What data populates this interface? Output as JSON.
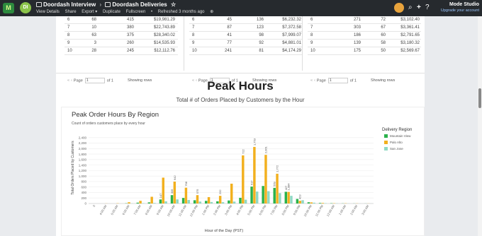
{
  "topbar": {
    "logo_letter": "M",
    "workspace_initials": "DI",
    "report_space": "Doordash Interview",
    "separator": "›",
    "report_title": "Doordash Deliveries",
    "star": "☆",
    "menu": [
      "View Details",
      "Share",
      "Export ▾",
      "Duplicate",
      "Fullscreen",
      "•",
      "Refreshed 3 months ago",
      "⊕"
    ],
    "org_name": "Mode Studio",
    "upgrade_text": "Upgrade your account",
    "icons": [
      "search-icon",
      "plus-icon",
      "help-icon"
    ]
  },
  "tables": [
    {
      "rows": [
        [
          "6",
          "68",
          "415",
          "$19,981.29"
        ],
        [
          "7",
          "10",
          "380",
          "$22,743.89"
        ],
        [
          "8",
          "63",
          "375",
          "$28,340.02"
        ],
        [
          "9",
          "3",
          "260",
          "$14,535.93"
        ],
        [
          "10",
          "28",
          "245",
          "$12,112.76"
        ]
      ]
    },
    {
      "rows": [
        [
          "6",
          "45",
          "136",
          "$6,232.32"
        ],
        [
          "7",
          "87",
          "123",
          "$7,372.58"
        ],
        [
          "8",
          "41",
          "98",
          "$7,999.07"
        ],
        [
          "9",
          "77",
          "92",
          "$4,881.01"
        ],
        [
          "10",
          "241",
          "81",
          "$4,174.29"
        ]
      ]
    },
    {
      "rows": [
        [
          "6",
          "271",
          "72",
          "$3,102.40"
        ],
        [
          "7",
          "303",
          "67",
          "$3,361.41"
        ],
        [
          "8",
          "186",
          "60",
          "$2,791.65"
        ],
        [
          "9",
          "139",
          "58",
          "$3,180.32"
        ],
        [
          "10",
          "175",
          "50",
          "$2,569.67"
        ]
      ]
    }
  ],
  "pager": {
    "page_label": "Page",
    "page_value": "1",
    "of_label": "of 1",
    "showing_label": "Showing rows"
  },
  "section": {
    "title": "Peak Hours",
    "subtitle": "Total # of Orders Placed by Customers by the Hour"
  },
  "chart_data": {
    "type": "bar",
    "title": "Peak Order Hours By Region",
    "description": "Count of orders customers place by every hour",
    "xlabel": "Hour of the Day (PST)",
    "ylabel": "Total Orders Placed by Customers",
    "ylim": [
      0,
      2600
    ],
    "yticks": [
      "0",
      "200",
      "400",
      "600",
      "800",
      "1,000",
      "1,200",
      "1,400",
      "1,600",
      "1,800",
      "2,000",
      "2,200",
      "2,400"
    ],
    "grid": true,
    "legend_title": "Delivery Region",
    "legend_position": "right",
    "categories": [
      "0",
      "4:00 AM",
      "5:00 AM",
      "6:00 AM",
      "7:00 AM",
      "8:00 AM",
      "9:00 AM",
      "10:00 AM",
      "11:00 AM",
      "12:00 PM",
      "1:00 PM",
      "2:00 PM",
      "3:00 PM",
      "4:00 PM",
      "5:00 PM",
      "6:00 PM",
      "7:00 PM",
      "8:00 PM",
      "9:00 PM",
      "10:00 PM",
      "11:00 PM",
      "12:00 AM",
      "1:00 AM",
      "2:00 AM",
      "3:00 AM"
    ],
    "tick_labels": [
      "0",
      "4:00 AM",
      "5:00 AM",
      "6:00 AM",
      "7:00 AM",
      "8:00 AM",
      "9:00 AM",
      "10:00 AM",
      "11:00 AM",
      "12:00 PM",
      "1:00 PM",
      "2:00 PM",
      "3:00 PM",
      "4:00 PM",
      "5:00 PM",
      "6:00 PM",
      "7:00 PM",
      "8:00 PM",
      "9:00 PM",
      "10:00 PM",
      "11:00 PM",
      "12:00 AM",
      "1:00 AM",
      "2:00 AM",
      "3:00 AM"
    ],
    "series": [
      {
        "name": "Mountain View",
        "color": "#2bb24c",
        "values": [
          0,
          0,
          0,
          8,
          30,
          40,
          147,
          305,
          202,
          119,
          96,
          80,
          110,
          208,
          617,
          638,
          569,
          427,
          166,
          45,
          20,
          10,
          5,
          3,
          2
        ]
      },
      {
        "name": "Palo Alto",
        "color": "#f2b01e",
        "values": [
          0,
          3,
          8,
          46,
          98,
          245,
          942,
          798,
          575,
          305,
          232,
          280,
          722,
          1753,
          2061,
          1772,
          1084,
          423,
          100,
          40,
          20,
          10,
          8,
          5,
          3
        ]
      },
      {
        "name": "San Jose",
        "color": "#8fd9c4",
        "values": [
          0,
          0,
          0,
          5,
          12,
          20,
          80,
          150,
          130,
          70,
          55,
          48,
          70,
          140,
          434,
          450,
          379,
          280,
          120,
          30,
          12,
          6,
          3,
          2,
          1
        ]
      }
    ],
    "data_labels": [
      {
        "text": "147",
        "cat": 6,
        "series": 0
      },
      {
        "text": "305",
        "cat": 7,
        "series": 0
      },
      {
        "text": "942",
        "cat": 7,
        "series": 1
      },
      {
        "text": "798",
        "cat": 8,
        "series": 1
      },
      {
        "text": "575",
        "cat": 9,
        "series": 1
      },
      {
        "text": "232",
        "cat": 11,
        "series": 1
      },
      {
        "text": "722",
        "cat": 13,
        "series": 1
      },
      {
        "text": "617",
        "cat": 14,
        "series": 0
      },
      {
        "text": "1,753",
        "cat": 14,
        "series": 1
      },
      {
        "text": "2,061",
        "cat": 15,
        "series": 1
      },
      {
        "text": "1,772",
        "cat": 16,
        "series": 1
      },
      {
        "text": "569",
        "cat": 16,
        "series": 0
      },
      {
        "text": "1,084",
        "cat": 17,
        "series": 1
      },
      {
        "text": "427",
        "cat": 17,
        "series": 0
      },
      {
        "text": "423",
        "cat": 18,
        "series": 1
      }
    ]
  }
}
